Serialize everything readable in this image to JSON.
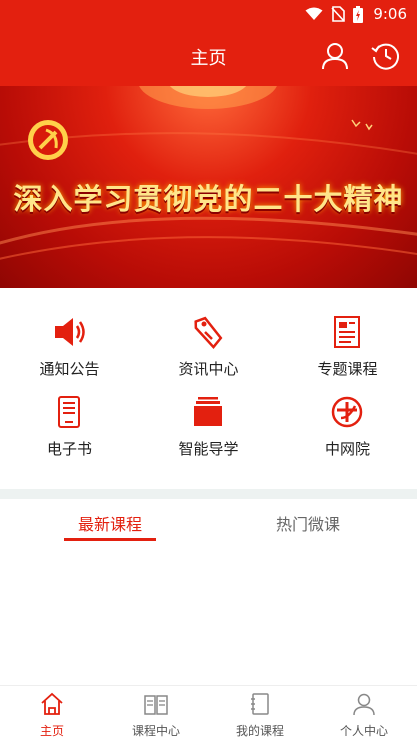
{
  "status_bar": {
    "time": "9:06"
  },
  "header": {
    "title": "主页"
  },
  "banner": {
    "text": "深入学习贯彻党的二十大精神"
  },
  "menu": {
    "items": [
      {
        "label": "通知公告",
        "icon": "megaphone-icon"
      },
      {
        "label": "资讯中心",
        "icon": "tag-icon"
      },
      {
        "label": "专题课程",
        "icon": "document-icon"
      },
      {
        "label": "电子书",
        "icon": "ebook-icon"
      },
      {
        "label": "智能导学",
        "icon": "book-stack-icon"
      },
      {
        "label": "中网院",
        "icon": "academy-logo-icon"
      }
    ]
  },
  "tabs": {
    "active": "最新课程",
    "inactive": "热门微课"
  },
  "bottom_nav": {
    "items": [
      {
        "label": "主页",
        "active": true
      },
      {
        "label": "课程中心",
        "active": false
      },
      {
        "label": "我的课程",
        "active": false
      },
      {
        "label": "个人中心",
        "active": false
      }
    ]
  },
  "colors": {
    "brand_red": "#e3200f",
    "text": "#222222",
    "inactive": "#555555"
  }
}
